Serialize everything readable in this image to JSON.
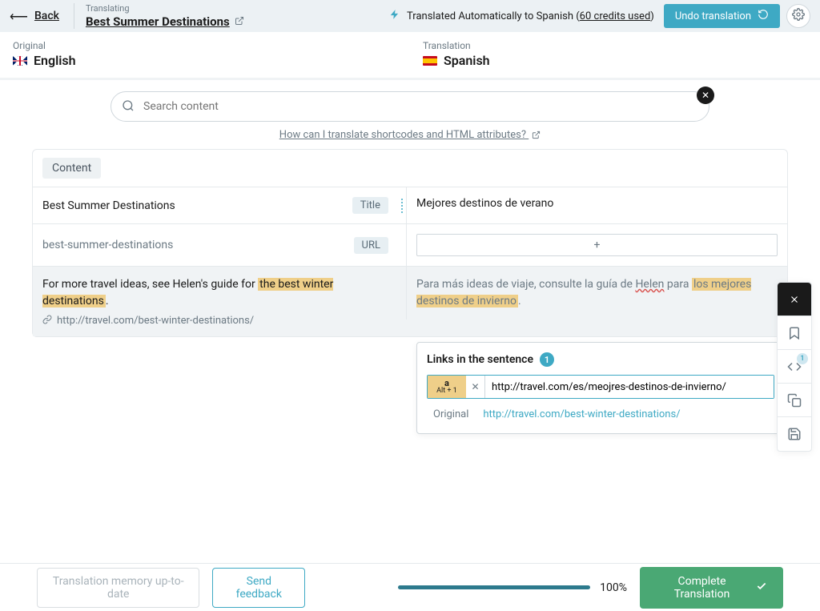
{
  "header": {
    "back": "Back",
    "translating_label": "Translating",
    "doc_title": "Best Summer Destinations",
    "auto_prefix": "Translated Automatically to Spanish (",
    "credits": "60 credits used",
    "auto_suffix": ")",
    "undo": "Undo translation"
  },
  "langs": {
    "orig_label": "Original",
    "orig_name": "English",
    "trans_label": "Translation",
    "trans_name": "Spanish"
  },
  "search": {
    "placeholder": "Search content"
  },
  "help": {
    "text": "How can I translate shortcodes and HTML attributes?"
  },
  "tabs": {
    "content": "Content"
  },
  "rows": {
    "title": {
      "source": "Best Summer Destinations",
      "pill": "Title",
      "target": "Mejores destinos de verano"
    },
    "slug": {
      "source": "best-summer-destinations",
      "pill": "URL"
    },
    "body": {
      "source_before": "For more travel ideas, see Helen's guide for ",
      "source_hl": "the best winter destinations",
      "source_after": ".",
      "link": "http://travel.com/best-winter-destinations/",
      "target_before": "Para más ideas de viaje, consulte la guía de ",
      "target_helen": "Helen",
      "target_mid": " para ",
      "target_hl": "los mejores destinos de invierno",
      "target_after": "."
    }
  },
  "links_panel": {
    "header": "Links in the sentence",
    "count": "1",
    "alt_a": "a",
    "alt_key": "Alt + 1",
    "input_value": "http://travel.com/es/meojres-destinos-de-invierno/",
    "orig_label": "Original",
    "orig_url": "http://travel.com/best-winter-destinations/"
  },
  "side": {
    "badge": "1"
  },
  "footer": {
    "memory": "Translation memory up-to-date",
    "feedback": "Send feedback",
    "percent": "100%",
    "complete": "Complete Translation"
  }
}
